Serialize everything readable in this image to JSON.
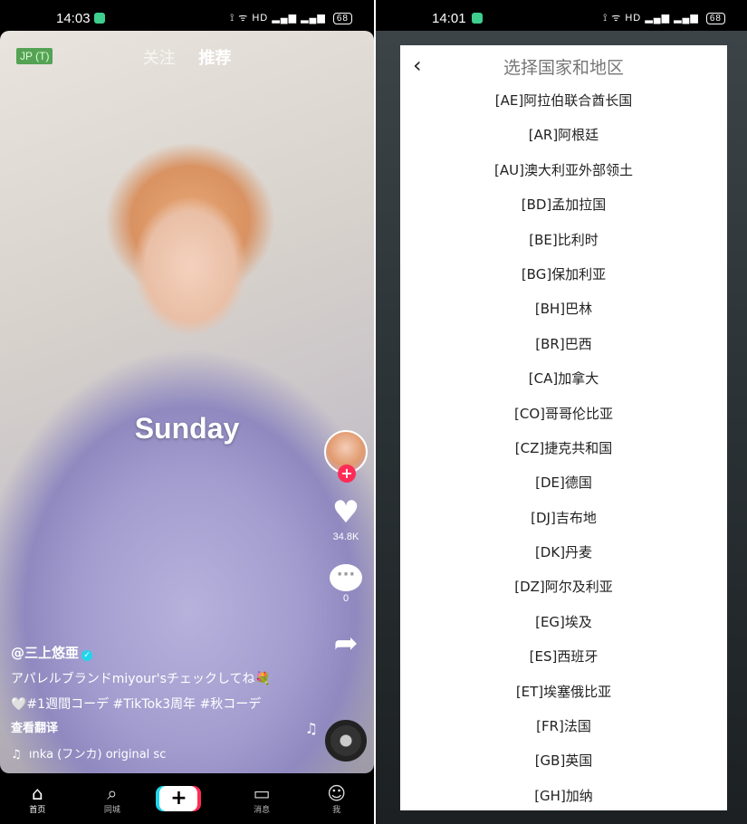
{
  "left": {
    "status": {
      "time": "14:03",
      "network": "HD",
      "battery": "68"
    },
    "region_tag": "JP (T)",
    "tabs": {
      "following": "关注",
      "for_you": "推荐"
    },
    "overlay_text": "Sunday",
    "actions": {
      "like_count": "34.8K",
      "comment_count": "0"
    },
    "caption": {
      "username": "@三上悠亜",
      "line1": "アパレルブランドmiyour'sチェックしてね💐",
      "line2": "🤍#1週間コーデ #TikTok3周年 #秋コーデ",
      "translate": "查看翻译"
    },
    "music": "ınka (フンカ)   original sc",
    "nav": {
      "home": "首页",
      "nearby": "同城",
      "create": "+",
      "inbox": "消息",
      "me": "我"
    }
  },
  "right": {
    "status": {
      "time": "14:01",
      "network": "HD",
      "battery": "68"
    },
    "dialog_title": "选择国家和地区",
    "countries": [
      "[AE]阿拉伯联合酋长国",
      "[AR]阿根廷",
      "[AU]澳大利亚外部领土",
      "[BD]孟加拉国",
      "[BE]比利时",
      "[BG]保加利亚",
      "[BH]巴林",
      "[BR]巴西",
      "[CA]加拿大",
      "[CO]哥哥伦比亚",
      "[CZ]捷克共和国",
      "[DE]德国",
      "[DJ]吉布地",
      "[DK]丹麦",
      "[DZ]阿尔及利亚",
      "[EG]埃及",
      "[ES]西班牙",
      "[ET]埃塞俄比亚",
      "[FR]法国",
      "[GB]英国",
      "[GH]加纳"
    ]
  },
  "colors": {
    "accent_red": "#fe2c55",
    "accent_cyan": "#20d5ec",
    "status_green": "#3ecf8e"
  },
  "icons": [
    "wifi-icon",
    "signal-icon",
    "battery-icon",
    "heart-icon",
    "comment-icon",
    "share-icon",
    "music-note-icon",
    "home-icon",
    "search-icon",
    "inbox-icon",
    "profile-icon",
    "back-chevron-icon"
  ]
}
